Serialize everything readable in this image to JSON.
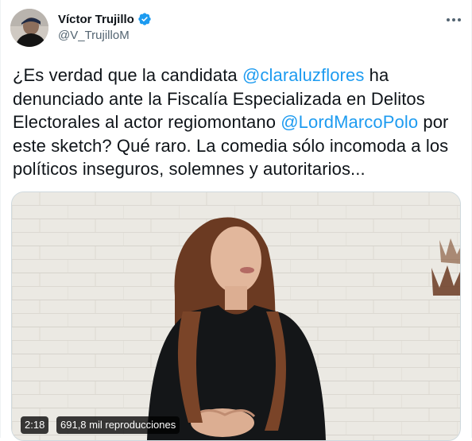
{
  "author": {
    "name": "Víctor Trujillo",
    "handle": "@V_TrujilloM",
    "verified": true
  },
  "tweet": {
    "segments": [
      {
        "text": "¿Es verdad que la candidata ",
        "type": "text"
      },
      {
        "text": "@claraluzflores",
        "type": "mention"
      },
      {
        "text": " ha denunciado ante la Fiscalía Especializada en Delitos Electorales al actor regiomontano ",
        "type": "text"
      },
      {
        "text": "@LordMarcoPolo",
        "type": "mention"
      },
      {
        "text": " por este sketch? Qué raro. La comedia sólo incomoda a los políticos inseguros, solemnes y autoritarios...",
        "type": "text"
      }
    ]
  },
  "video": {
    "duration": "2:18",
    "views": "691,8 mil reproducciones"
  },
  "colors": {
    "accent": "#1d9bf0",
    "text": "#0f1419",
    "secondary": "#536471"
  },
  "icons": {
    "verified": "verified-badge-icon",
    "more": "more-options-icon"
  }
}
